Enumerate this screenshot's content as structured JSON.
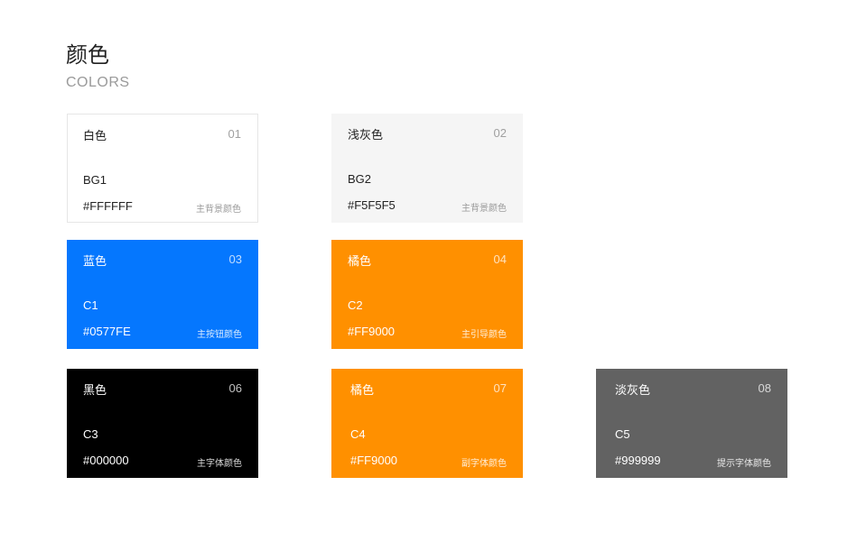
{
  "header": {
    "title": "颜色",
    "subtitle": "COLORS"
  },
  "cards": [
    {
      "name": "白色",
      "number": "01",
      "code": "BG1",
      "hex": "#FFFFFF",
      "usage": "主背景颜色",
      "color": "#FFFFFF"
    },
    {
      "name": "浅灰色",
      "number": "02",
      "code": "BG2",
      "hex": "#F5F5F5",
      "usage": "主背景颜色",
      "color": "#F5F5F5"
    },
    {
      "name": "蓝色",
      "number": "03",
      "code": "C1",
      "hex": "#0577FE",
      "usage": "主按钮颜色",
      "color": "#0577FE"
    },
    {
      "name": "橘色",
      "number": "04",
      "code": "C2",
      "hex": "#FF9000",
      "usage": "主引导颜色",
      "color": "#FF9000"
    },
    {
      "name": "黑色",
      "number": "06",
      "code": "C3",
      "hex": "#000000",
      "usage": "主字体颜色",
      "color": "#000000"
    },
    {
      "name": "橘色",
      "number": "07",
      "code": "C4",
      "hex": "#FF9000",
      "usage": "副字体颜色",
      "color": "#FF9000"
    },
    {
      "name": "淡灰色",
      "number": "08",
      "code": "C5",
      "hex": "#999999",
      "usage": "提示字体颜色",
      "color": "#626262"
    }
  ]
}
